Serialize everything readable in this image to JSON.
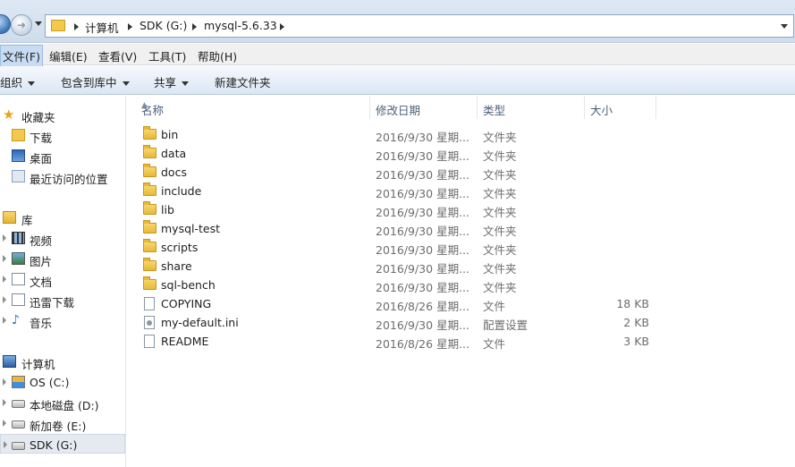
{
  "address": {
    "breadcrumbs": [
      "计算机",
      "SDK (G:)",
      "mysql-5.6.33"
    ]
  },
  "menu": {
    "items": [
      "文件(F)",
      "编辑(E)",
      "查看(V)",
      "工具(T)",
      "帮助(H)"
    ]
  },
  "toolbar": {
    "organize": "组织",
    "include_in_library": "包含到库中",
    "share": "共享",
    "new_folder": "新建文件夹"
  },
  "sidebar": {
    "favorites": "收藏夹",
    "downloads": "下载",
    "desktop": "桌面",
    "recent": "最近访问的位置",
    "libraries": "库",
    "videos": "视频",
    "pictures": "图片",
    "documents": "文档",
    "thunder": "迅雷下载",
    "music": "音乐",
    "computer": "计算机",
    "drive_c": "OS (C:)",
    "drive_d": "本地磁盘 (D:)",
    "drive_e": "新加卷 (E:)",
    "drive_g": "SDK (G:)"
  },
  "columns": {
    "name": "名称",
    "date": "修改日期",
    "type": "类型",
    "size": "大小"
  },
  "files": [
    {
      "name": "bin",
      "date": "2016/9/30 星期...",
      "type": "文件夹",
      "size": "",
      "icon": "folder"
    },
    {
      "name": "data",
      "date": "2016/9/30 星期...",
      "type": "文件夹",
      "size": "",
      "icon": "folder"
    },
    {
      "name": "docs",
      "date": "2016/9/30 星期...",
      "type": "文件夹",
      "size": "",
      "icon": "folder"
    },
    {
      "name": "include",
      "date": "2016/9/30 星期...",
      "type": "文件夹",
      "size": "",
      "icon": "folder"
    },
    {
      "name": "lib",
      "date": "2016/9/30 星期...",
      "type": "文件夹",
      "size": "",
      "icon": "folder"
    },
    {
      "name": "mysql-test",
      "date": "2016/9/30 星期...",
      "type": "文件夹",
      "size": "",
      "icon": "folder"
    },
    {
      "name": "scripts",
      "date": "2016/9/30 星期...",
      "type": "文件夹",
      "size": "",
      "icon": "folder"
    },
    {
      "name": "share",
      "date": "2016/9/30 星期...",
      "type": "文件夹",
      "size": "",
      "icon": "folder"
    },
    {
      "name": "sql-bench",
      "date": "2016/9/30 星期...",
      "type": "文件夹",
      "size": "",
      "icon": "folder"
    },
    {
      "name": "COPYING",
      "date": "2016/8/26 星期...",
      "type": "文件",
      "size": "18 KB",
      "icon": "file"
    },
    {
      "name": "my-default.ini",
      "date": "2016/9/30 星期...",
      "type": "配置设置",
      "size": "2 KB",
      "icon": "ini"
    },
    {
      "name": "README",
      "date": "2016/8/26 星期...",
      "type": "文件",
      "size": "3 KB",
      "icon": "file"
    }
  ]
}
